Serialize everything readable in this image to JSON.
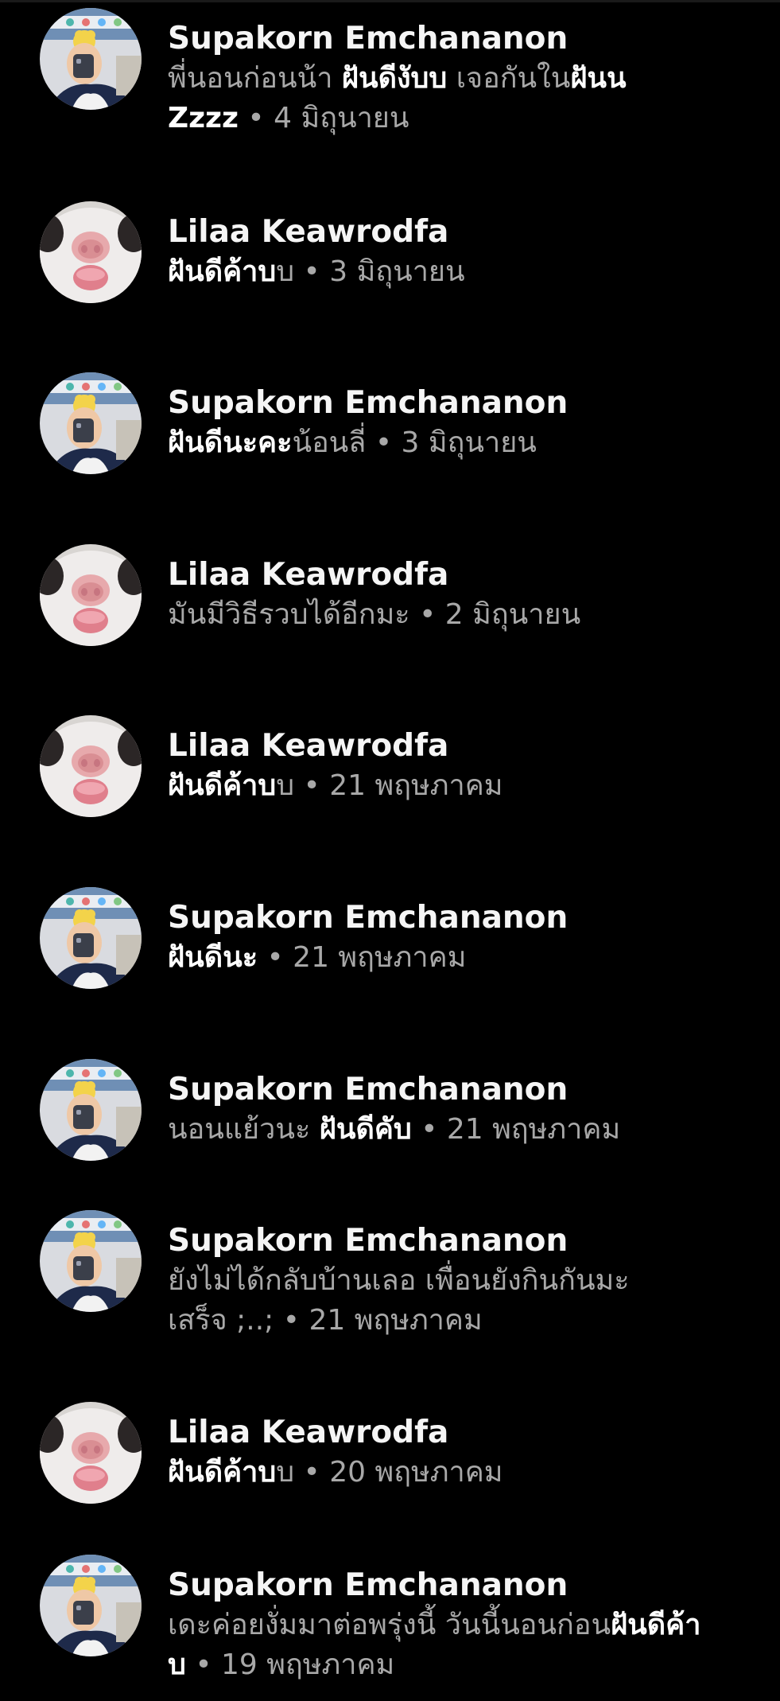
{
  "colors": {
    "background": "#000000",
    "name": "#f5f5f5",
    "unread_text": "#ffffff",
    "read_text": "#a8a8a8"
  },
  "separator": "•",
  "messages": [
    {
      "sender": "Supakorn Emchananon",
      "avatar": "supakorn-avatar-icon",
      "lines": [
        [
          {
            "t": "พี่นอนก่อนน้า ",
            "b": false
          },
          {
            "t": "ฝันดีงับบ",
            "b": true
          },
          {
            "t": " เจอกันใน",
            "b": false
          },
          {
            "t": "ฝันน",
            "b": true
          }
        ],
        [
          {
            "t": "Zzzz",
            "b": true
          }
        ]
      ],
      "time": "4 มิถุนายน"
    },
    {
      "sender": "Lilaa Keawrodfa",
      "avatar": "lilaa-avatar-icon",
      "lines": [
        [
          {
            "t": "ฝันดีค้าบ",
            "b": true
          },
          {
            "t": "บ",
            "b": false
          }
        ]
      ],
      "time": "3 มิถุนายน"
    },
    {
      "sender": "Supakorn Emchananon",
      "avatar": "supakorn-avatar-icon",
      "lines": [
        [
          {
            "t": "ฝันดีนะคะ",
            "b": true
          },
          {
            "t": "น้อนลี่",
            "b": false
          }
        ]
      ],
      "time": "3 มิถุนายน"
    },
    {
      "sender": "Lilaa Keawrodfa",
      "avatar": "lilaa-avatar-icon",
      "lines": [
        [
          {
            "t": "มันมีวิธีรวบได้อีกมะ",
            "b": false
          }
        ]
      ],
      "time": "2 มิถุนายน"
    },
    {
      "sender": "Lilaa Keawrodfa",
      "avatar": "lilaa-avatar-icon",
      "lines": [
        [
          {
            "t": "ฝันดีค้าบ",
            "b": true
          },
          {
            "t": "บ",
            "b": false
          }
        ]
      ],
      "time": "21 พฤษภาคม"
    },
    {
      "sender": "Supakorn Emchananon",
      "avatar": "supakorn-avatar-icon",
      "lines": [
        [
          {
            "t": "ฝันดีนะ",
            "b": true
          }
        ]
      ],
      "time": "21 พฤษภาคม"
    },
    {
      "sender": "Supakorn Emchananon",
      "avatar": "supakorn-avatar-icon",
      "lines": [
        [
          {
            "t": "นอนแย้วนะ ",
            "b": false
          },
          {
            "t": "ฝันดีคับ",
            "b": true
          }
        ]
      ],
      "time": "21 พฤษภาคม"
    },
    {
      "sender": "Supakorn Emchananon",
      "avatar": "supakorn-avatar-icon",
      "lines": [
        [
          {
            "t": "ยังไม่ได้กลับบ้านเลอ เพื่อนยังกินกันมะ",
            "b": false
          }
        ],
        [
          {
            "t": "เสร็จ ;..;",
            "b": false
          }
        ]
      ],
      "time": "21 พฤษภาคม"
    },
    {
      "sender": "Lilaa Keawrodfa",
      "avatar": "lilaa-avatar-icon",
      "lines": [
        [
          {
            "t": "ฝันดีค้าบ",
            "b": true
          },
          {
            "t": "บ",
            "b": false
          }
        ]
      ],
      "time": "20 พฤษภาคม"
    },
    {
      "sender": "Supakorn Emchananon",
      "avatar": "supakorn-avatar-icon",
      "lines": [
        [
          {
            "t": "เดะค่อยงั่มมาต่อพรุ่งนี้ วันนี้นอนก่อน",
            "b": false
          },
          {
            "t": "ฝันดีค้า",
            "b": true
          }
        ],
        [
          {
            "t": "บ",
            "b": true
          }
        ]
      ],
      "time": "19 พฤษภาคม"
    }
  ]
}
